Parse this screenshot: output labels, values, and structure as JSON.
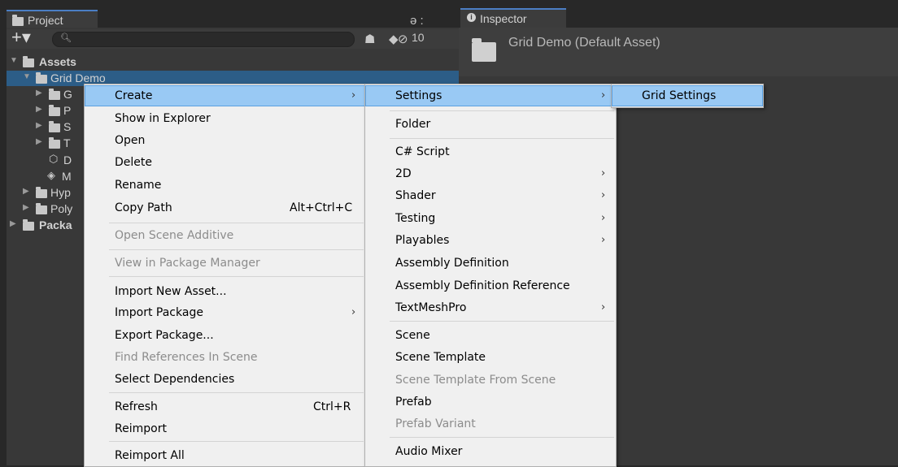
{
  "project": {
    "tab_title": "Project",
    "tab_menu_glyph": "ə :",
    "toolbar": {
      "create_label": "+▾",
      "search_placeholder": "",
      "hidden_count": "10"
    },
    "tree": [
      {
        "label": "Assets",
        "bold": true
      },
      {
        "label": "Grid Demo",
        "selected": true
      },
      {
        "label": "G"
      },
      {
        "label": "P"
      },
      {
        "label": "S"
      },
      {
        "label": "T"
      },
      {
        "label": "D"
      },
      {
        "label": "M"
      },
      {
        "label": "Hyp"
      },
      {
        "label": "Poly"
      },
      {
        "label": "Packa",
        "bold": true
      }
    ]
  },
  "inspector": {
    "tab_title": "Inspector",
    "asset_title": "Grid Demo (Default Asset)"
  },
  "menu_main": [
    {
      "label": "Create",
      "submenu": true,
      "highlighted": true
    },
    {
      "label": "Show in Explorer"
    },
    {
      "label": "Open"
    },
    {
      "label": "Delete"
    },
    {
      "label": "Rename"
    },
    {
      "label": "Copy Path",
      "shortcut": "Alt+Ctrl+C"
    },
    {
      "label": "Open Scene Additive",
      "disabled": true
    },
    {
      "label": "View in Package Manager",
      "disabled": true
    },
    {
      "label": "Import New Asset..."
    },
    {
      "label": "Import Package",
      "submenu": true
    },
    {
      "label": "Export Package..."
    },
    {
      "label": "Find References In Scene",
      "disabled": true
    },
    {
      "label": "Select Dependencies"
    },
    {
      "label": "Refresh",
      "shortcut": "Ctrl+R"
    },
    {
      "label": "Reimport"
    },
    {
      "label": "Reimport All"
    }
  ],
  "menu_create": [
    {
      "label": "Settings",
      "submenu": true,
      "highlighted": true
    },
    {
      "label": "Folder"
    },
    {
      "label": "C# Script"
    },
    {
      "label": "2D",
      "submenu": true
    },
    {
      "label": "Shader",
      "submenu": true
    },
    {
      "label": "Testing",
      "submenu": true
    },
    {
      "label": "Playables",
      "submenu": true
    },
    {
      "label": "Assembly Definition"
    },
    {
      "label": "Assembly Definition Reference"
    },
    {
      "label": "TextMeshPro",
      "submenu": true
    },
    {
      "label": "Scene"
    },
    {
      "label": "Scene Template"
    },
    {
      "label": "Scene Template From Scene",
      "disabled": true
    },
    {
      "label": "Prefab"
    },
    {
      "label": "Prefab Variant",
      "disabled": true
    },
    {
      "label": "Audio Mixer"
    }
  ],
  "menu_settings": [
    {
      "label": "Grid Settings",
      "highlighted": true
    }
  ],
  "glyphs": {
    "submenu_arrow": "›"
  },
  "colors": {
    "selection": "#2c5d87",
    "menu_highlight": "#99c9f4",
    "tab_accent": "#4b7ec4"
  }
}
